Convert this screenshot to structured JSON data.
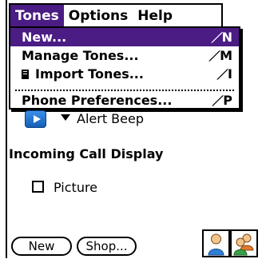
{
  "menubar": {
    "menus": [
      {
        "label": "Tones",
        "active": true
      },
      {
        "label": "Options",
        "active": false
      },
      {
        "label": "Help",
        "active": false
      }
    ]
  },
  "dropdown": {
    "items": [
      {
        "label": "New...",
        "shortcut": "N",
        "selected": true
      },
      {
        "label": "Manage Tones...",
        "shortcut": "M",
        "selected": false
      },
      {
        "label": "Import Tones...",
        "shortcut": "I",
        "selected": false,
        "icon": "file-icon"
      },
      {
        "label": "Phone Preferences...",
        "shortcut": "P",
        "selected": false
      }
    ]
  },
  "background": {
    "hidden_label_1": "[",
    "hidden_label_2": "[",
    "alert_tone": "Alert Beep",
    "section_title": "Incoming Call Display",
    "checkbox_label": "Picture",
    "checkbox_checked": false
  },
  "buttons": {
    "new_label": "New",
    "shop_label": "Shop..."
  },
  "icons": {
    "single_contact": "person-icon",
    "group_contacts": "people-icon"
  },
  "colors": {
    "accent": "#4b1c84",
    "play_button": "#1f6fd0"
  }
}
